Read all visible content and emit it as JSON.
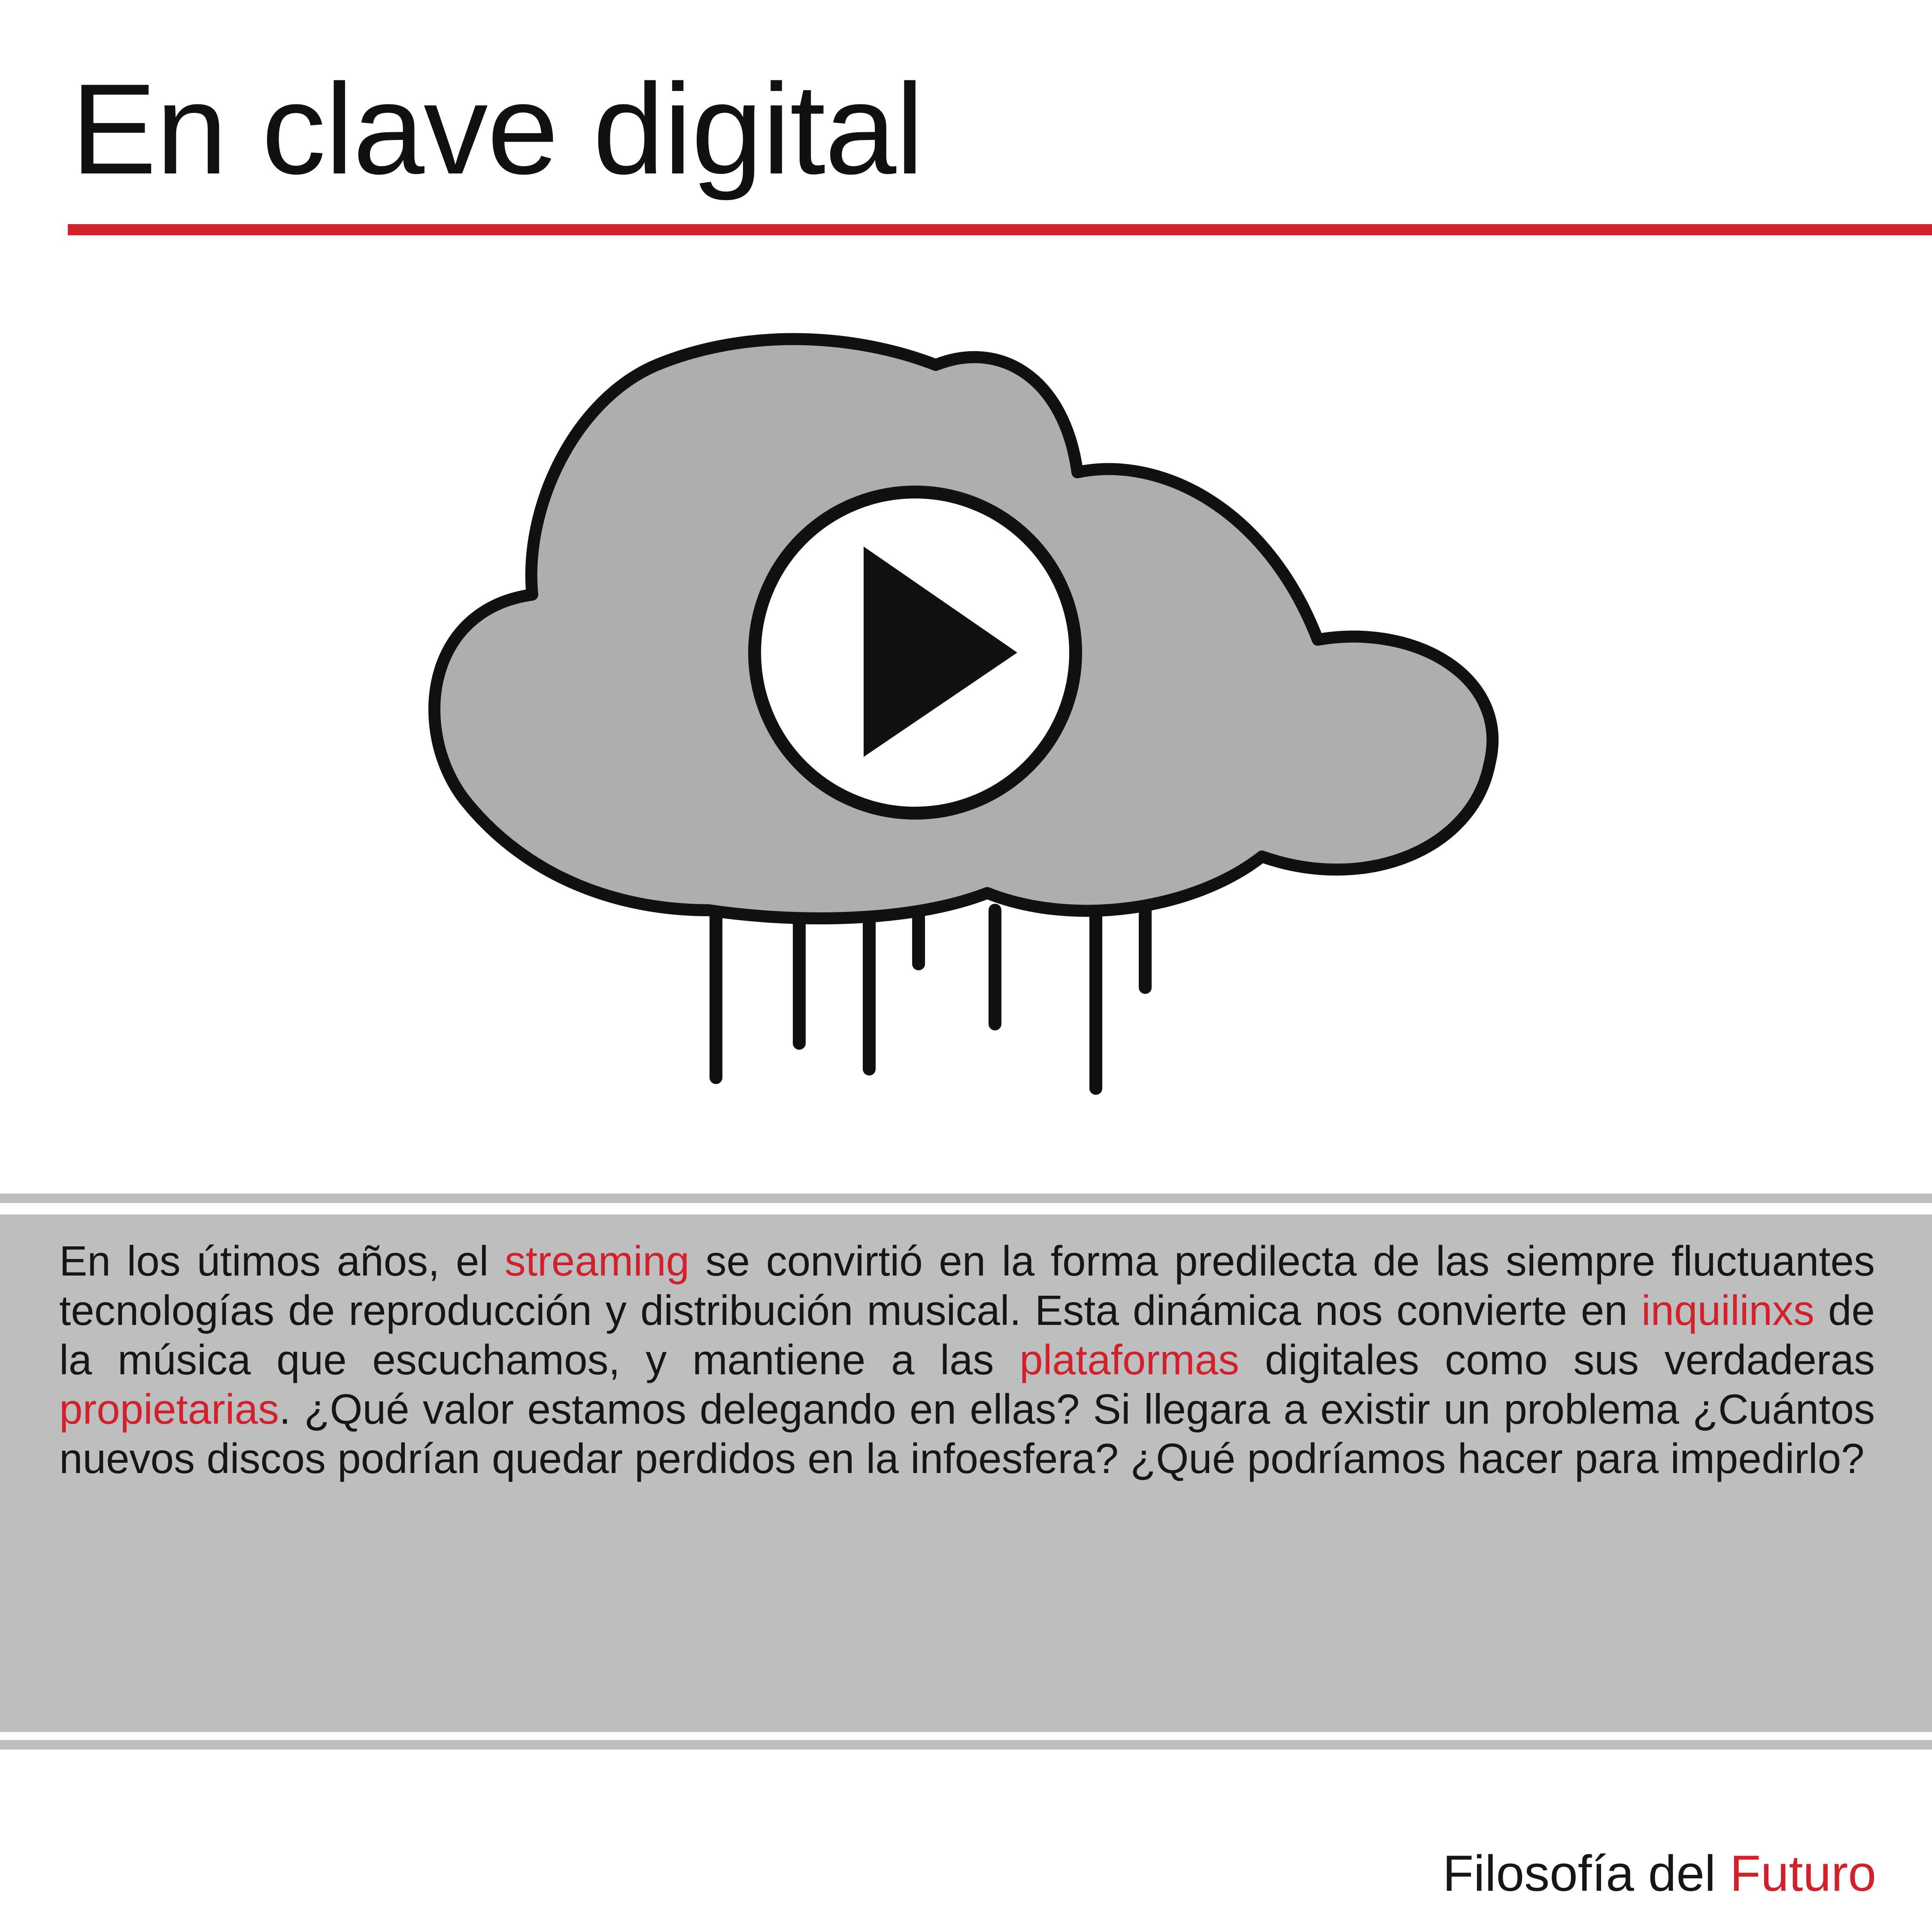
{
  "header": {
    "title": "En clave digital"
  },
  "illustration": {
    "icon": "cloud-play-icon"
  },
  "body": {
    "segments": [
      {
        "text": "En los útimos años, el ",
        "highlight": false
      },
      {
        "text": "streaming",
        "highlight": true
      },
      {
        "text": " se convirtió en la forma predilecta de las siem­pre fluctuantes tecnologías de reproducción y distribución musical. Esta dinámi­ca nos convierte en ",
        "highlight": false
      },
      {
        "text": "inquilinxs",
        "highlight": true
      },
      {
        "text": " de la música que escuchamos, y mantiene a las ",
        "highlight": false
      },
      {
        "text": "plataformas",
        "highlight": true
      },
      {
        "text": " digitales como sus verdaderas ",
        "highlight": false
      },
      {
        "text": "propietarias",
        "highlight": true
      },
      {
        "text": ". ¿Qué valor estamos del­egando en ellas? Si llegara a existir un problema ¿Cuántos nuevos discos po­drían quedar perdidos en la infoesfera? ¿Qué podríamos hacer para impedirlo?",
        "highlight": false
      }
    ]
  },
  "footer": {
    "prefix": "Filosofía del ",
    "accent": "Futuro"
  },
  "colors": {
    "accent": "#d1222b",
    "band": "#bdbec0",
    "cloud_fill": "#adafae",
    "ink": "#111111"
  }
}
